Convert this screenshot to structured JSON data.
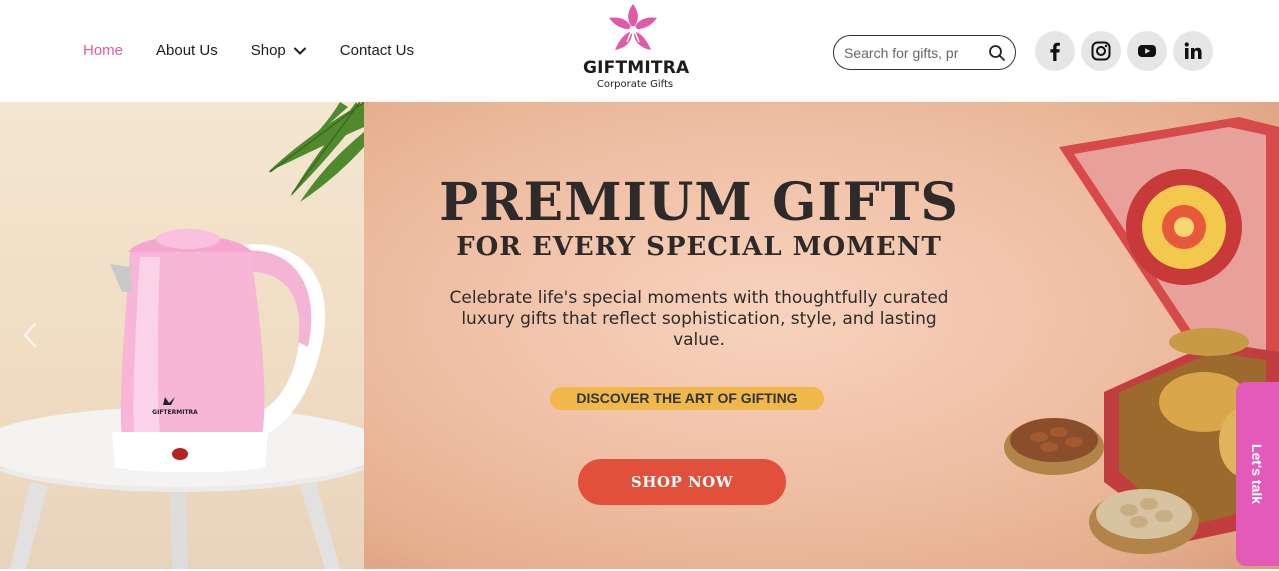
{
  "nav": {
    "items": [
      {
        "label": "Home",
        "active": true
      },
      {
        "label": "About Us"
      },
      {
        "label": "Shop",
        "has_dropdown": true
      },
      {
        "label": "Contact Us"
      }
    ]
  },
  "logo": {
    "brand": "GIFTMITRA",
    "tagline": "Corporate Gifts",
    "color": "#e05aa7"
  },
  "search": {
    "placeholder": "Search for gifts, pr",
    "icon": "search-icon"
  },
  "social": [
    "facebook-icon",
    "instagram-icon",
    "youtube-icon",
    "linkedin-icon"
  ],
  "hero": {
    "headline": "PREMIUM GIFTS",
    "subheadline": "FOR EVERY SPECIAL MOMENT",
    "description": "Celebrate life's special moments with thoughtfully curated luxury gifts that reflect sophistication, style, and lasting value.",
    "pill_text": "DISCOVER THE ART OF GIFTING",
    "cta": "SHOP NOW",
    "kettle_brand": "GIFTERMITRA",
    "colors": {
      "cta": "#e0503a",
      "pill": "#f0b84a",
      "accent": "#e35ab9"
    }
  },
  "float": {
    "lets_talk": "Let's talk"
  }
}
